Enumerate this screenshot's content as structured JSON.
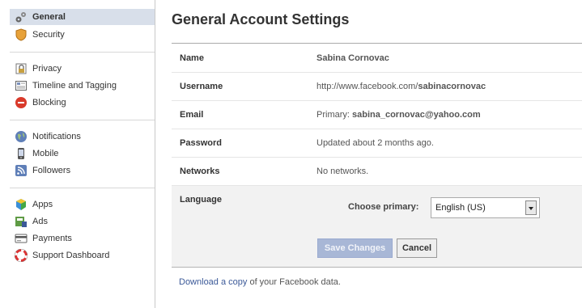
{
  "sidebar": {
    "items": [
      {
        "label": "General",
        "icon": "gears-icon"
      },
      {
        "label": "Security",
        "icon": "shield-icon"
      },
      {
        "label": "Privacy",
        "icon": "lock-icon"
      },
      {
        "label": "Timeline and Tagging",
        "icon": "timeline-icon"
      },
      {
        "label": "Blocking",
        "icon": "block-icon"
      },
      {
        "label": "Notifications",
        "icon": "globe-icon"
      },
      {
        "label": "Mobile",
        "icon": "phone-icon"
      },
      {
        "label": "Followers",
        "icon": "rss-icon"
      },
      {
        "label": "Apps",
        "icon": "apps-cube-icon"
      },
      {
        "label": "Ads",
        "icon": "ads-icon"
      },
      {
        "label": "Payments",
        "icon": "card-icon"
      },
      {
        "label": "Support Dashboard",
        "icon": "lifebuoy-icon"
      }
    ]
  },
  "main": {
    "title": "General Account Settings",
    "rows": [
      {
        "label": "Name",
        "value": "Sabina Cornovac"
      },
      {
        "label": "Username",
        "prefix": "http://www.facebook.com/",
        "value": "sabinacornovac"
      },
      {
        "label": "Email",
        "prefix": "Primary: ",
        "value": "sabina_cornovac@yahoo.com"
      },
      {
        "label": "Password",
        "value": "Updated about 2 months ago."
      },
      {
        "label": "Networks",
        "value": "No networks."
      }
    ],
    "language": {
      "label": "Language",
      "choose_label": "Choose primary:",
      "selected": "English (US)",
      "save": "Save Changes",
      "cancel": "Cancel"
    },
    "download": {
      "link": "Download a copy",
      "rest": " of your Facebook data."
    }
  },
  "colors": {
    "link": "#3b5998",
    "selected_bg": "#d8dfea",
    "save_btn": "#a8b7d6"
  }
}
